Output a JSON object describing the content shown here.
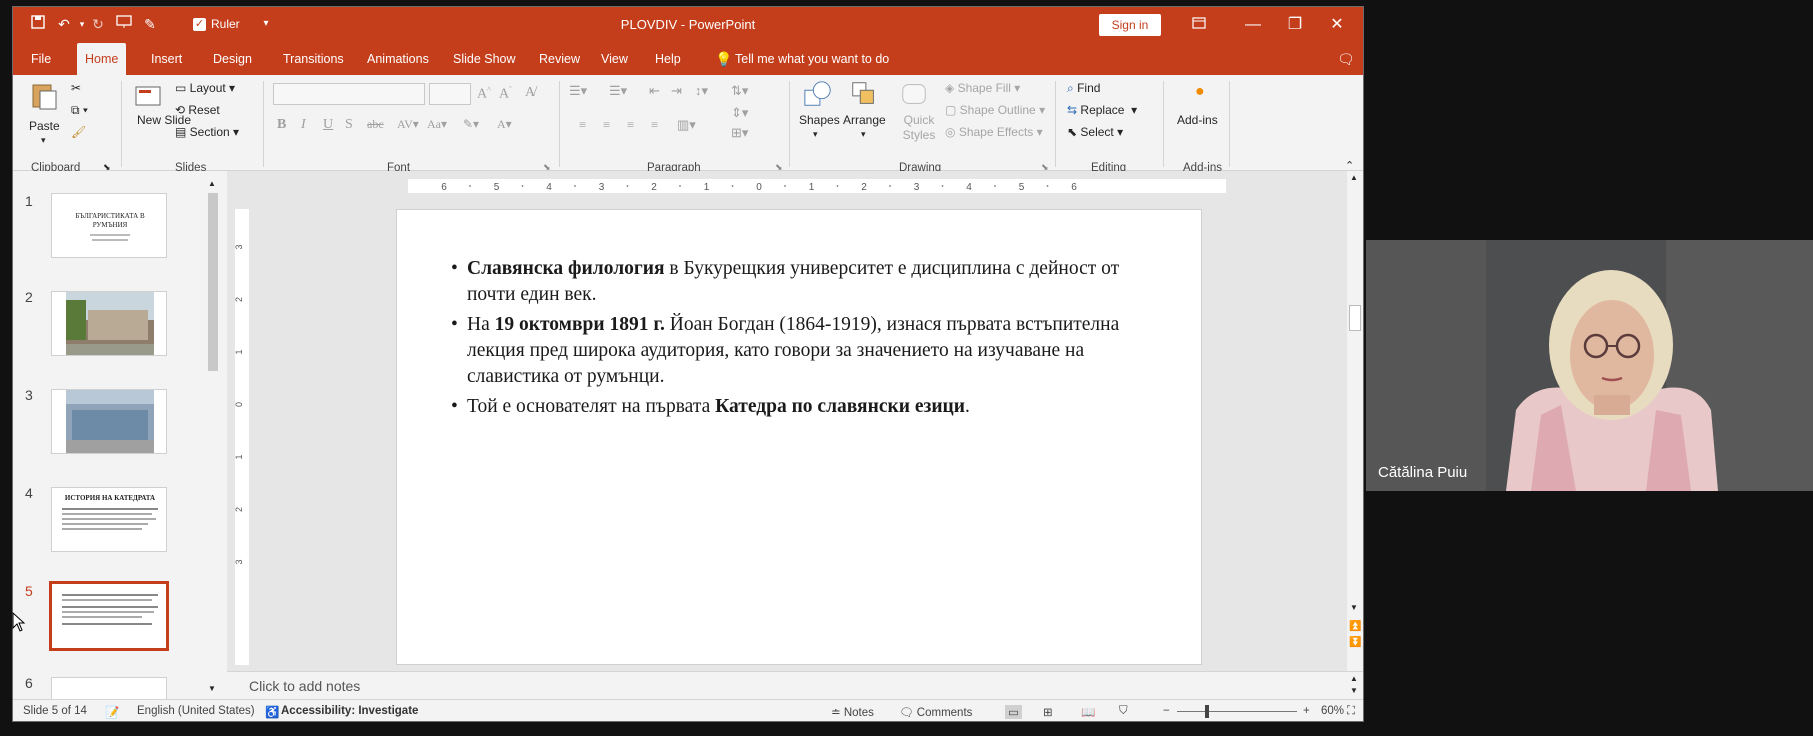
{
  "titlebar": {
    "quick_access": [
      "save-icon",
      "undo-icon",
      "redo-icon",
      "present-icon",
      "pen-icon"
    ],
    "ruler_label": "Ruler",
    "doc_title": "PLOVDIV  -  PowerPoint",
    "signin": "Sign in",
    "accent": "#c43e1c"
  },
  "menubar": {
    "tabs": [
      "File",
      "Home",
      "Insert",
      "Design",
      "Transitions",
      "Animations",
      "Slide Show",
      "Review",
      "View",
      "Help"
    ],
    "active": "Home",
    "tell_me": "Tell me what you want to do"
  },
  "ribbon": {
    "clipboard": {
      "label": "Clipboard",
      "paste": "Paste"
    },
    "slides": {
      "label": "Slides",
      "new_slide": "New Slide",
      "layout": "Layout",
      "reset": "Reset",
      "section": "Section"
    },
    "font": {
      "label": "Font"
    },
    "paragraph": {
      "label": "Paragraph"
    },
    "drawing": {
      "label": "Drawing",
      "shapes": "Shapes",
      "arrange": "Arrange",
      "quick_styles": "Quick Styles",
      "shape_fill": "Shape Fill",
      "shape_outline": "Shape Outline",
      "shape_effects": "Shape Effects"
    },
    "editing": {
      "label": "Editing",
      "find": "Find",
      "replace": "Replace",
      "select": "Select"
    },
    "addins": {
      "label": "Add-ins",
      "addins": "Add-ins"
    }
  },
  "thumbnails": [
    {
      "num": "1",
      "title": "БЪЛГАРИСТИКАТА В РУМЪНИЯ"
    },
    {
      "num": "2"
    },
    {
      "num": "3"
    },
    {
      "num": "4",
      "title": "ИСТОРИЯ НА КАТЕДРАТА"
    },
    {
      "num": "5",
      "selected": true
    },
    {
      "num": "6"
    }
  ],
  "ruler": {
    "h_ticks": [
      "6",
      "5",
      "4",
      "3",
      "2",
      "1",
      "0",
      "1",
      "2",
      "3",
      "4",
      "5",
      "6"
    ],
    "v_ticks": [
      "3",
      "2",
      "1",
      "0",
      "1",
      "2",
      "3"
    ]
  },
  "slide": {
    "b1_bold": "Славянска филология",
    "b1_rest": " в Букурещкия университет е дисциплина с дейност от почти един век.",
    "b2_pre": "На ",
    "b2_bold": "19 октомври 1891 г.",
    "b2_rest": "  Йоан Богдан (1864-1919), изнася първата встъпителна лекция пред широка аудитория, като говори за значението на изучаване на славистика от румънци.",
    "b3_pre": " Той е основателят на първата ",
    "b3_bold": "Катедра по славянски езици",
    "b3_end": "."
  },
  "notes_placeholder": "Click to add notes",
  "statusbar": {
    "slide_info": "Slide 5 of 14",
    "language": "English (United States)",
    "accessibility": "Accessibility: Investigate",
    "notes": "Notes",
    "comments": "Comments",
    "zoom": "60%"
  },
  "video": {
    "participant": "Cătălina Puiu"
  }
}
